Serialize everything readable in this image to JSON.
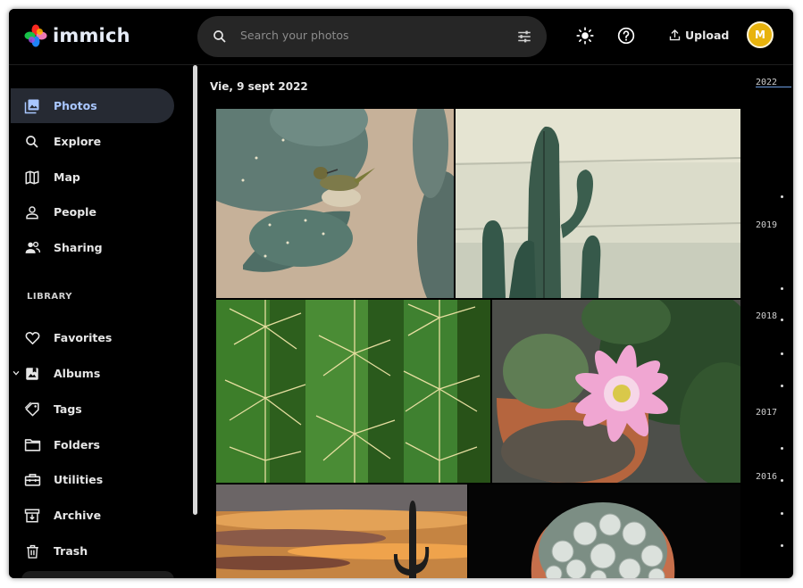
{
  "app": {
    "name": "immich"
  },
  "header": {
    "search_placeholder": "Search your photos",
    "upload_label": "Upload",
    "avatar_initial": "M"
  },
  "sidebar": {
    "items": [
      {
        "label": "Photos",
        "icon": "photos-icon",
        "active": true
      },
      {
        "label": "Explore",
        "icon": "search-icon"
      },
      {
        "label": "Map",
        "icon": "map-icon"
      },
      {
        "label": "People",
        "icon": "person-icon"
      },
      {
        "label": "Sharing",
        "icon": "people-icon"
      }
    ],
    "library_label": "LIBRARY",
    "library_items": [
      {
        "label": "Favorites",
        "icon": "heart-icon"
      },
      {
        "label": "Albums",
        "icon": "album-icon"
      },
      {
        "label": "Tags",
        "icon": "tag-icon"
      },
      {
        "label": "Folders",
        "icon": "folder-icon"
      },
      {
        "label": "Utilities",
        "icon": "toolbox-icon"
      },
      {
        "label": "Archive",
        "icon": "archive-icon"
      },
      {
        "label": "Trash",
        "icon": "trash-icon"
      }
    ]
  },
  "main": {
    "date_group": "Vie, 9 sept 2022"
  },
  "timeline": {
    "years": [
      "2022",
      "2019",
      "2018",
      "2017",
      "2016"
    ]
  },
  "colors": {
    "accent": "#a9c7ff",
    "avatar": "#e8b30d",
    "background": "#000000"
  }
}
